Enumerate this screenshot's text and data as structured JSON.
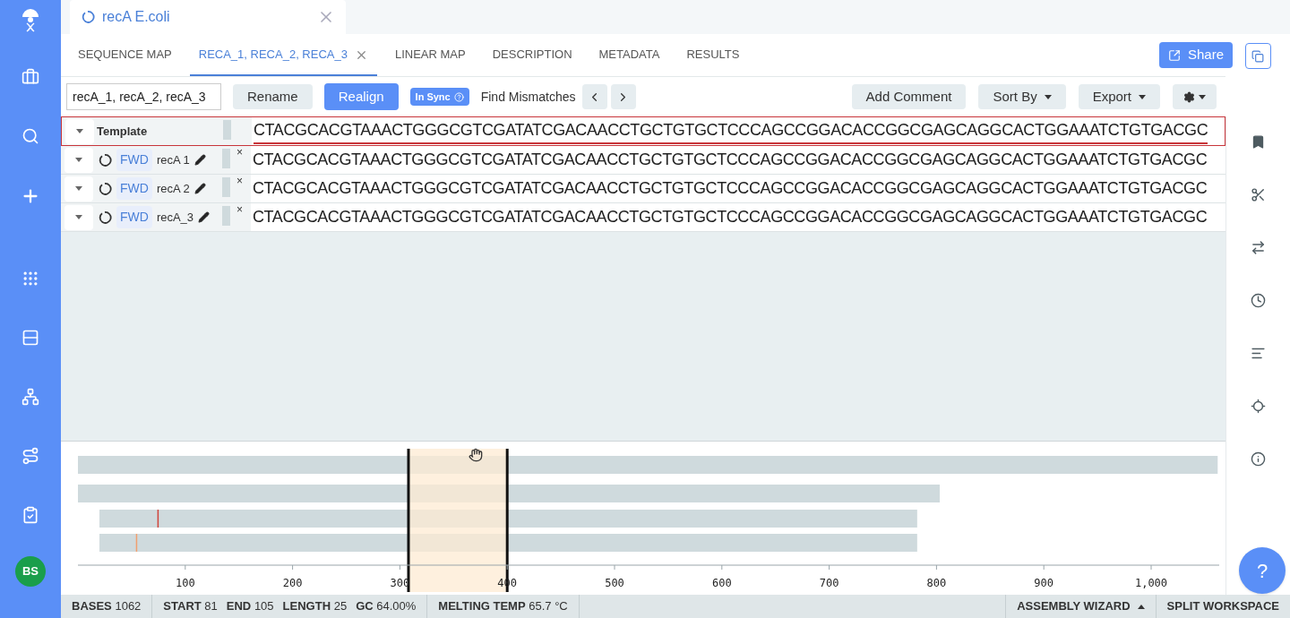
{
  "app_sidebar": {
    "avatar": "BS"
  },
  "document_tab": {
    "title": "recA E.coli"
  },
  "tabs": [
    {
      "label": "SEQUENCE MAP",
      "selected": false,
      "closable": false
    },
    {
      "label": "RECA_1, RECA_2, RECA_3",
      "selected": true,
      "closable": true
    },
    {
      "label": "LINEAR MAP",
      "selected": false,
      "closable": false
    },
    {
      "label": "DESCRIPTION",
      "selected": false,
      "closable": false
    },
    {
      "label": "METADATA",
      "selected": false,
      "closable": false
    },
    {
      "label": "RESULTS",
      "selected": false,
      "closable": false
    }
  ],
  "share_button": "Share",
  "toolbar": {
    "name_field": "recA_1, recA_2, recA_3",
    "rename": "Rename",
    "realign": "Realign",
    "sync_badge": "In Sync",
    "find_mismatches": "Find Mismatches",
    "add_comment": "Add Comment",
    "sort_by": "Sort By",
    "export": "Export"
  },
  "alignment": {
    "rows": [
      {
        "kind": "template",
        "label": "Template",
        "selected": true,
        "sequence": "CTACGCACGTAAACTGGGCGTCGATATCGACAACCTGCTGTGCTCCCAGCCGGACACCGGCGAGCAGGCACTGGAAATCTGTGACGC"
      },
      {
        "kind": "read",
        "direction": "FWD",
        "label": "recA 1",
        "close": "×",
        "selected": false,
        "sequence": "CTACGCACGTAAACTGGGCGTCGATATCGACAACCTGCTGTGCTCCCAGCCGGACACCGGCGAGCAGGCACTGGAAATCTGTGACGC"
      },
      {
        "kind": "read",
        "direction": "FWD",
        "label": "recA 2",
        "close": "×",
        "selected": false,
        "sequence": "CTACGCACGTAAACTGGGCGTCGATATCGACAACCTGCTGTGCTCCCAGCCGGACACCGGCGAGCAGGCACTGGAAATCTGTGACGC"
      },
      {
        "kind": "read",
        "direction": "FWD",
        "label": "recA_3",
        "close": "×",
        "selected": false,
        "sequence": "CTACGCACGTAAACTGGGCGTCGATATCGACAACCTGCTGTGCTCCCAGCCGGACACCGGCGAGCAGGCACTGGAAATCTGTGACGC"
      }
    ]
  },
  "overview": {
    "axis_labels": [
      "100",
      "200",
      "300",
      "400",
      "500",
      "600",
      "700",
      "800",
      "900",
      "1,000"
    ]
  },
  "status_bar": {
    "segments": [
      [
        {
          "label": "BASES",
          "value": "1062"
        }
      ],
      [
        {
          "label": "START",
          "value": "81"
        },
        {
          "label": "END",
          "value": "105"
        },
        {
          "label": "LENGTH",
          "value": "25"
        },
        {
          "label": "GC",
          "value": "64.00%"
        }
      ],
      [
        {
          "label": "MELTING TEMP",
          "value": "65.7 °C"
        }
      ]
    ],
    "assembly_wizard": "ASSEMBLY WIZARD",
    "split_workspace": "SPLIT WORKSPACE"
  },
  "help_button": "?"
}
